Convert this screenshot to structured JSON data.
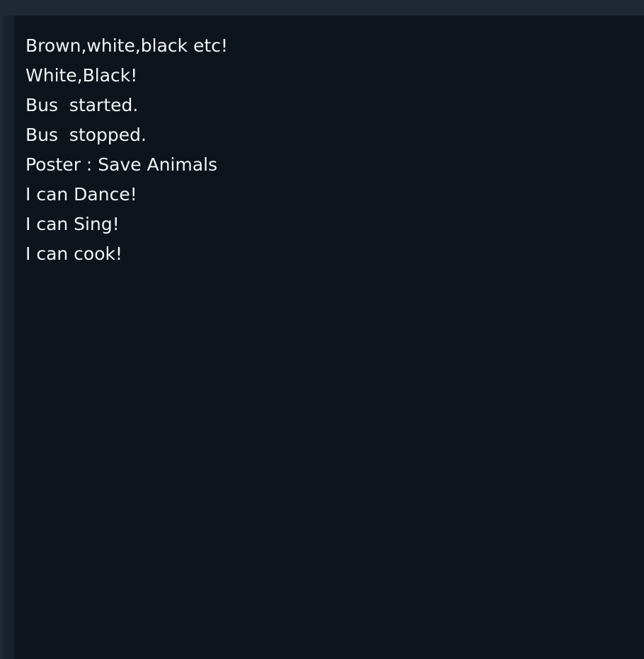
{
  "console": {
    "lines": [
      "Brown,white,black etc!",
      "White,Black!",
      "Bus  started.",
      "Bus  stopped.",
      "Poster : Save Animals",
      "I can Dance!",
      "I can Sing!",
      "I can cook!"
    ]
  },
  "colors": {
    "panel_background": "#0e141b",
    "text": "#f2f4f6",
    "chrome": "#1f2933"
  }
}
